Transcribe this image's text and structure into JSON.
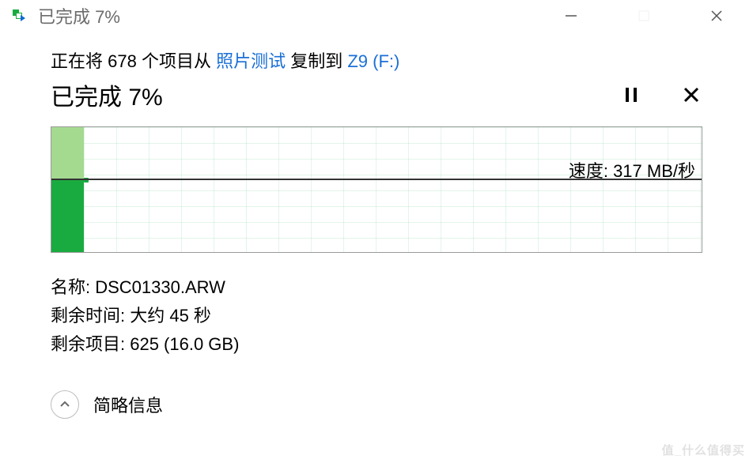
{
  "titlebar": {
    "title": "已完成 7%"
  },
  "description": {
    "prefix": "正在将 ",
    "count": "678",
    "middle": " 个项目从 ",
    "source": "照片测试",
    "between": " 复制到 ",
    "destination": "Z9 (F:)"
  },
  "progress": {
    "label_prefix": "已完成 ",
    "percent": "7%"
  },
  "speed": {
    "label": "速度: ",
    "value": "317 MB/秒"
  },
  "details": {
    "name_label": "名称: ",
    "name_value": "DSC01330.ARW",
    "time_label": "剩余时间: ",
    "time_value": "大约 45 秒",
    "items_label": "剩余项目: ",
    "items_value": "625 (16.0 GB)"
  },
  "footer": {
    "label": "简略信息"
  },
  "watermark": "值_什么值得买",
  "chart_data": {
    "type": "area",
    "progress_fraction": 0.05,
    "upper_band_fill": "#a4da90",
    "lower_band_fill": "#1aab40",
    "midline_position_pct": 41,
    "speed_overlay": "速度: 317 MB/秒"
  }
}
